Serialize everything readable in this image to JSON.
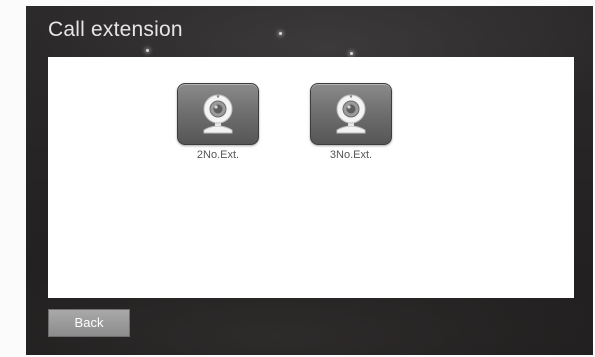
{
  "screen": {
    "title": "Call extension"
  },
  "extensions": [
    {
      "label": "2No.Ext.",
      "icon": "webcam-icon"
    },
    {
      "label": "3No.Ext.",
      "icon": "webcam-icon"
    }
  ],
  "footer": {
    "back_label": "Back"
  },
  "colors": {
    "background": "#262424",
    "panel": "#ffffff",
    "button_gray": "#8c8c8c",
    "title_text": "#e6e6e6"
  }
}
